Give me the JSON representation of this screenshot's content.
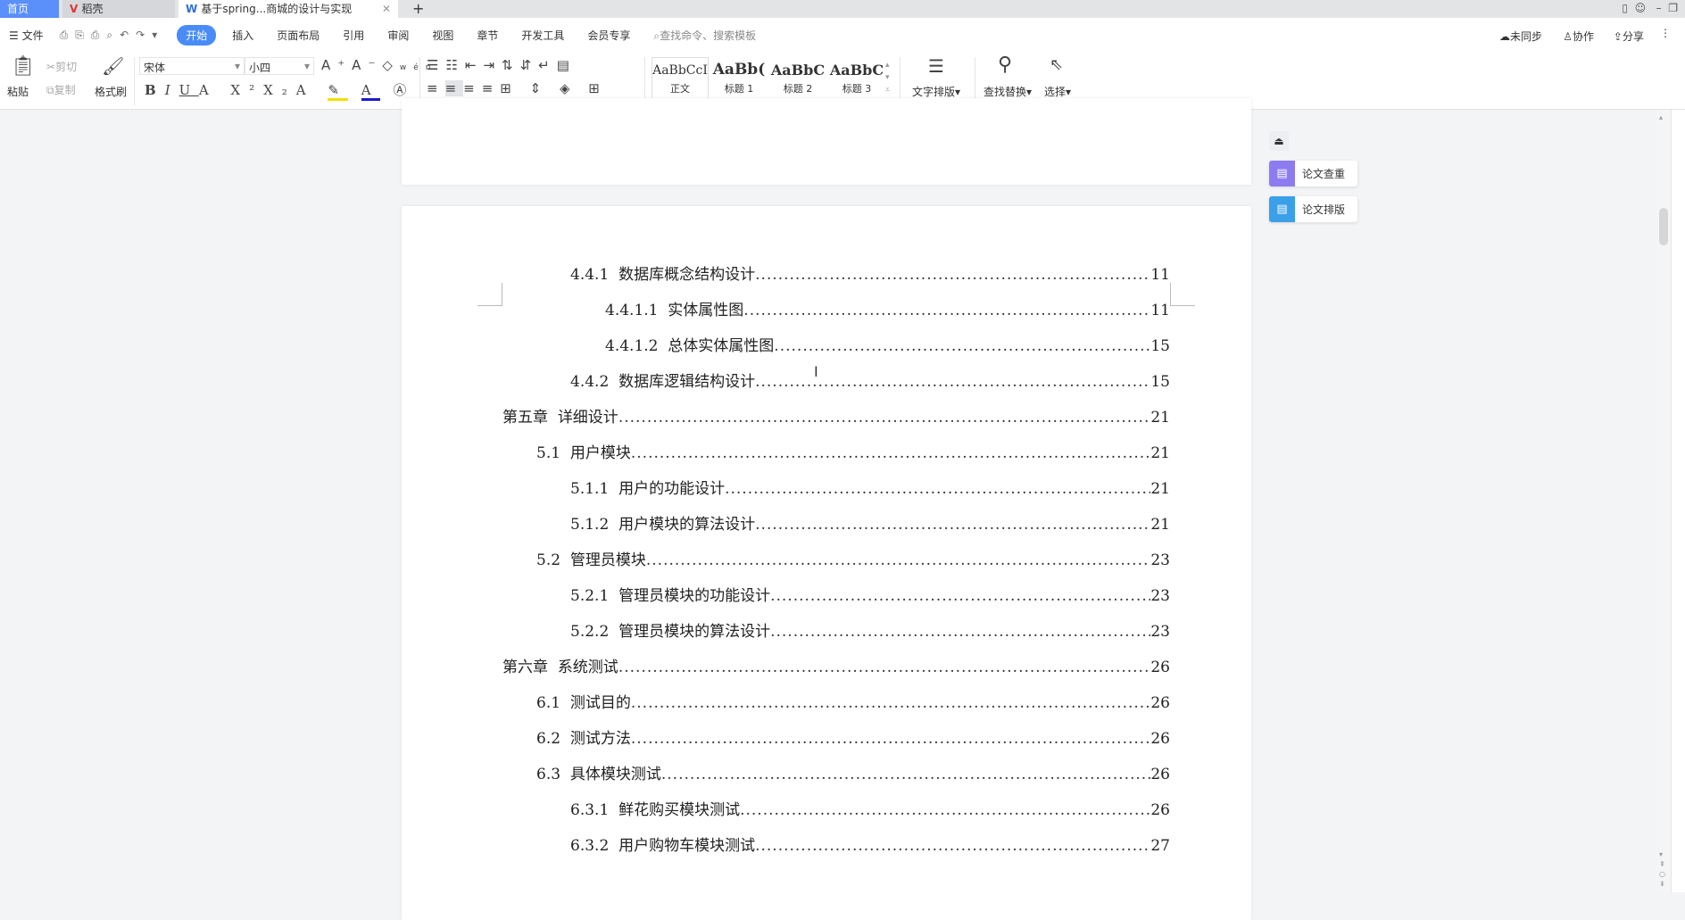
{
  "tabs": [
    {
      "label": "首页",
      "active": false
    },
    {
      "label": "稻壳",
      "active": false
    },
    {
      "label": "基于spring...商城的设计与实现",
      "active": true
    }
  ],
  "menu": {
    "file": "文件",
    "items": [
      "开始",
      "插入",
      "页面布局",
      "引用",
      "审阅",
      "视图",
      "章节",
      "开发工具",
      "会员专享"
    ],
    "search_placeholder": "查找命令、搜索模板",
    "sync": "未同步",
    "collab": "协作",
    "share": "分享"
  },
  "ribbon": {
    "paste": "粘贴",
    "cut": "剪切",
    "copy": "复制",
    "format_painter": "格式刷",
    "font": "宋体",
    "size": "小四",
    "styles": [
      {
        "preview": "AaBbCcI",
        "label": "正文"
      },
      {
        "preview": "AaBb(",
        "label": "标题 1"
      },
      {
        "preview": "AaBbC",
        "label": "标题 2"
      },
      {
        "preview": "AaBbC",
        "label": "标题 3"
      }
    ],
    "text_layout": "文字排版",
    "find_replace": "查找替换",
    "select": "选择",
    "pinyin": "wén"
  },
  "side_panel": {
    "check": "论文查重",
    "layout": "论文排版"
  },
  "colors": {
    "accent": "#4a8cf7",
    "check": "#8c7cf0",
    "layout": "#3aa0e8"
  },
  "toc": [
    {
      "level": 3,
      "num": "4.4.1",
      "title": "数据库概念结构设计",
      "page": "11"
    },
    {
      "level": 4,
      "num": "4.4.1.1",
      "title": "实体属性图",
      "page": "11"
    },
    {
      "level": 4,
      "num": "4.4.1.2",
      "title": "总体实体属性图",
      "page": "15"
    },
    {
      "level": 3,
      "num": "4.4.2",
      "title": "数据库逻辑结构设计",
      "page": "15"
    },
    {
      "level": 1,
      "num": "第五章",
      "title": "详细设计",
      "page": "21"
    },
    {
      "level": 2,
      "num": "5.1",
      "title": "用户模块",
      "page": "21"
    },
    {
      "level": 3,
      "num": "5.1.1",
      "title": "用户的功能设计",
      "page": "21"
    },
    {
      "level": 3,
      "num": "5.1.2",
      "title": "用户模块的算法设计",
      "page": "21"
    },
    {
      "level": 2,
      "num": "5.2",
      "title": "管理员模块",
      "page": "23"
    },
    {
      "level": 3,
      "num": "5.2.1",
      "title": "管理员模块的功能设计",
      "page": "23"
    },
    {
      "level": 3,
      "num": "5.2.2",
      "title": "管理员模块的算法设计",
      "page": "23"
    },
    {
      "level": 1,
      "num": "第六章",
      "title": "系统测试",
      "page": "26"
    },
    {
      "level": 2,
      "num": "6.1",
      "title": "测试目的",
      "page": "26"
    },
    {
      "level": 2,
      "num": "6.2",
      "title": "测试方法",
      "page": "26"
    },
    {
      "level": 2,
      "num": "6.3",
      "title": "具体模块测试",
      "page": "26"
    },
    {
      "level": 3,
      "num": "6.3.1",
      "title": "鲜花购买模块测试",
      "page": "26"
    },
    {
      "level": 3,
      "num": "6.3.2",
      "title": "用户购物车模块测试",
      "page": "27"
    }
  ]
}
